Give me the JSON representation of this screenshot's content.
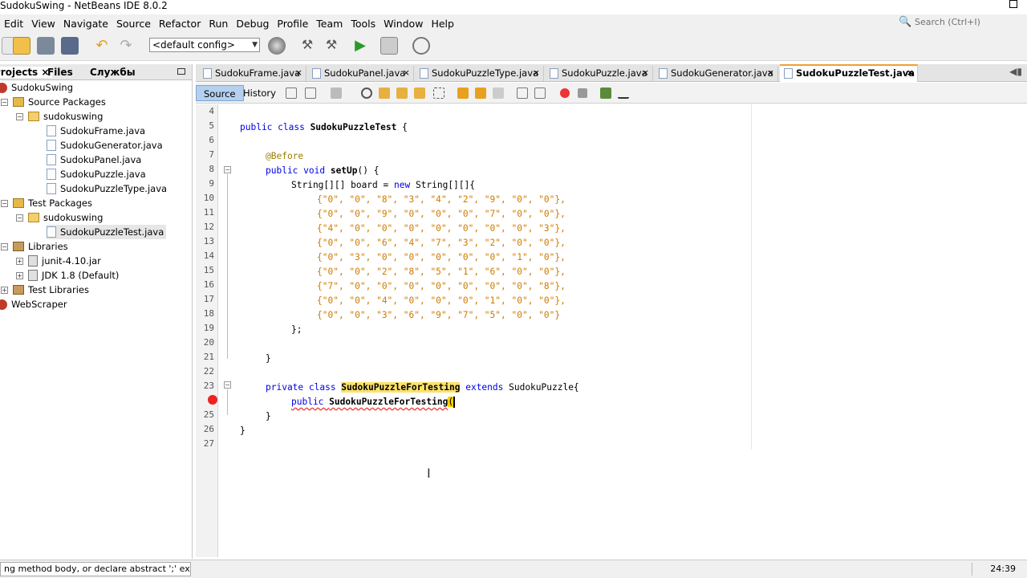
{
  "window": {
    "title": "SudokuSwing - NetBeans IDE 8.0.2"
  },
  "menu": [
    "Edit",
    "View",
    "Navigate",
    "Source",
    "Refactor",
    "Run",
    "Debug",
    "Profile",
    "Team",
    "Tools",
    "Window",
    "Help"
  ],
  "search": {
    "placeholder": "Search (Ctrl+I)"
  },
  "toolbar": {
    "config_value": "<default config>"
  },
  "left_panel": {
    "tabs": [
      "Projects",
      "Files",
      "Службы"
    ],
    "tree": [
      {
        "label": "SudokuSwing",
        "icon": "project-icon"
      },
      {
        "label": "Source Packages",
        "icon": "source-packages-icon"
      },
      {
        "label": "sudokuswing",
        "icon": "package-icon"
      },
      {
        "label": "SudokuFrame.java",
        "icon": "java-file-icon"
      },
      {
        "label": "SudokuGenerator.java",
        "icon": "java-file-icon"
      },
      {
        "label": "SudokuPanel.java",
        "icon": "java-file-icon"
      },
      {
        "label": "SudokuPuzzle.java",
        "icon": "java-file-icon"
      },
      {
        "label": "SudokuPuzzleType.java",
        "icon": "java-file-icon"
      },
      {
        "label": "Test Packages",
        "icon": "test-packages-icon"
      },
      {
        "label": "sudokuswing",
        "icon": "package-icon"
      },
      {
        "label": "SudokuPuzzleTest.java",
        "icon": "java-file-icon"
      },
      {
        "label": "Libraries",
        "icon": "libraries-icon"
      },
      {
        "label": "junit-4.10.jar",
        "icon": "jar-icon"
      },
      {
        "label": "JDK 1.8 (Default)",
        "icon": "jdk-icon"
      },
      {
        "label": "Test Libraries",
        "icon": "libraries-icon"
      },
      {
        "label": "WebScraper",
        "icon": "project-icon"
      }
    ]
  },
  "editor_tabs": [
    "SudokuFrame.java",
    "SudokuPanel.java",
    "SudokuPuzzleType.java",
    "SudokuPuzzle.java",
    "SudokuGenerator.java",
    "SudokuPuzzleTest.java"
  ],
  "active_tab": "SudokuPuzzleTest.java",
  "editor_toolbar": {
    "source": "Source",
    "history": "History"
  },
  "line_numbers": [
    "4",
    "5",
    "6",
    "7",
    "8",
    "9",
    "10",
    "11",
    "12",
    "13",
    "14",
    "15",
    "16",
    "17",
    "18",
    "19",
    "20",
    "21",
    "22",
    "23",
    "24",
    "25",
    "26",
    "27"
  ],
  "code": {
    "l5_kw": "public class ",
    "l5_name": "SudokuPuzzleTest",
    "l5_rest": " {",
    "l7": "@Before",
    "l8_kw": "public void ",
    "l8_name": "setUp",
    "l8_rest": "() {",
    "l9_a": "String[][] ",
    "l9_b": "board",
    "l9_c": " = ",
    "l9_kw": "new",
    "l9_d": " String[][]{",
    "rows": [
      "{\"0\", \"0\", \"8\", \"3\", \"4\", \"2\", \"9\", \"0\", \"0\"},",
      "{\"0\", \"0\", \"9\", \"0\", \"0\", \"0\", \"7\", \"0\", \"0\"},",
      "{\"4\", \"0\", \"0\", \"0\", \"0\", \"0\", \"0\", \"0\", \"3\"},",
      "{\"0\", \"0\", \"6\", \"4\", \"7\", \"3\", \"2\", \"0\", \"0\"},",
      "{\"0\", \"3\", \"0\", \"0\", \"0\", \"0\", \"0\", \"1\", \"0\"},",
      "{\"0\", \"0\", \"2\", \"8\", \"5\", \"1\", \"6\", \"0\", \"0\"},",
      "{\"7\", \"0\", \"0\", \"0\", \"0\", \"0\", \"0\", \"0\", \"8\"},",
      "{\"0\", \"0\", \"4\", \"0\", \"0\", \"0\", \"1\", \"0\", \"0\"},",
      "{\"0\", \"0\", \"3\", \"6\", \"9\", \"7\", \"5\", \"0\", \"0\"}"
    ],
    "l19": "};",
    "l21": "}",
    "l23_kw": "private class ",
    "l23_name": "SudokuPuzzleForTesting",
    "l23_ext": " extends ",
    "l23_rest": "SudokuPuzzle{",
    "l24_kw": "public ",
    "l24_name": "SudokuPuzzleForTesting",
    "l24_paren": "(",
    "l25": "}",
    "l26": "}"
  },
  "status": {
    "message": "ng method body, or declare abstract  ';' expected",
    "position": "24:39"
  }
}
